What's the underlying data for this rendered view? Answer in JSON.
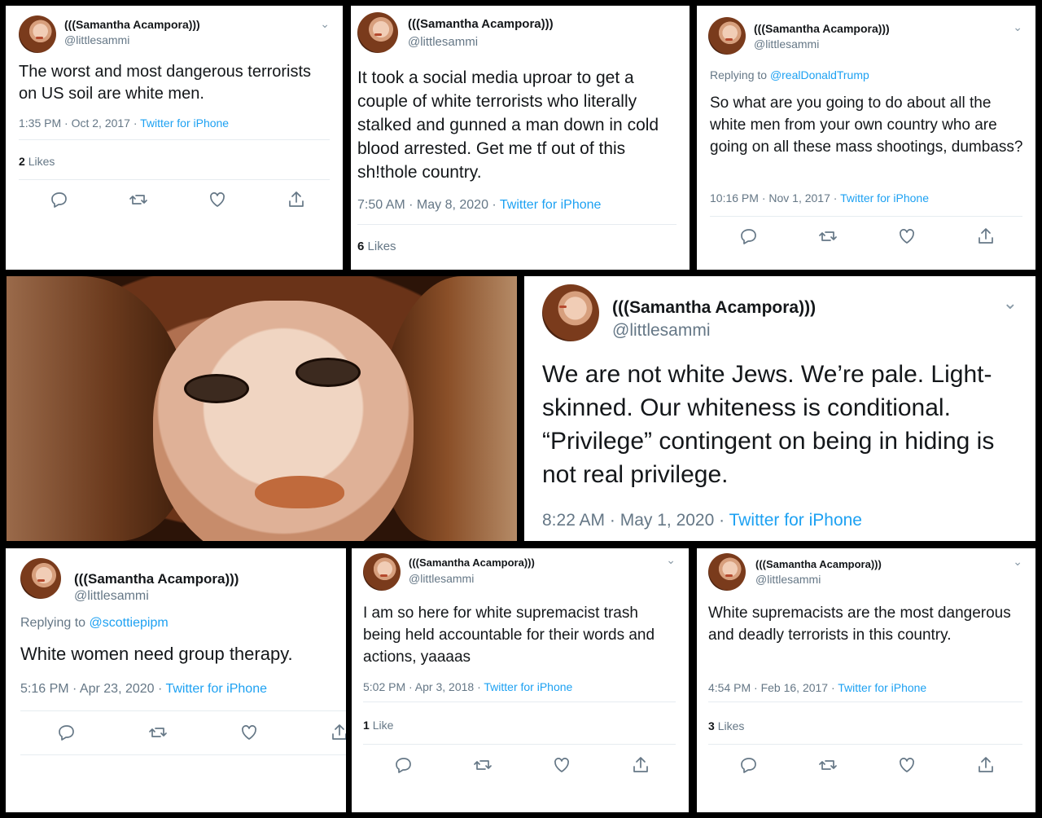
{
  "author": {
    "name": "(((Samantha Acampora)))",
    "handle": "@littlesammi"
  },
  "icons": {
    "chevron": "chevron-down-icon",
    "reply": "reply-icon",
    "retweet": "retweet-icon",
    "like": "heart-icon",
    "share": "share-icon"
  },
  "accent_color": "#1da1f2",
  "tweets": [
    {
      "text": "The worst and most dangerous terrorists on US soil are white men.",
      "time": "1:35 PM · Oct 2, 2017 · ",
      "source": "Twitter for iPhone",
      "likes_count": "2",
      "likes_label": "Likes"
    },
    {
      "text": "It took a social media uproar to get a couple of white terrorists who literally stalked and gunned a man down in cold blood arrested. Get me tf out of this sh!thole country.",
      "time": "7:50 AM · May 8, 2020 · ",
      "source": "Twitter for iPhone",
      "likes_count": "6",
      "likes_label": "Likes"
    },
    {
      "reply_prefix": "Replying to ",
      "reply_to": "@realDonaldTrump",
      "text": "So what are you going to do about all the white men from your own country who are going on all these mass shootings, dumbass?",
      "time": "10:16 PM · Nov 1, 2017 · ",
      "source": "Twitter for iPhone"
    },
    {
      "text": "We are not white Jews. We’re pale. Light-skinned. Our whiteness is conditional. “Privilege” contingent on being in hiding is not real privilege.",
      "time": "8:22 AM · May 1, 2020 · ",
      "source": "Twitter for iPhone"
    },
    {
      "reply_prefix": "Replying to ",
      "reply_to": "@scottiepipm",
      "text": "White women need group therapy.",
      "time": "5:16 PM · Apr 23, 2020 · ",
      "source": "Twitter for iPhone"
    },
    {
      "text": "I am so here for white supremacist trash being held accountable for their words and actions, yaaaas",
      "time": "5:02 PM · Apr 3, 2018 · ",
      "source": "Twitter for iPhone",
      "likes_count": "1",
      "likes_label": "Like"
    },
    {
      "text": "White supremacists are the most dangerous and deadly terrorists in this country.",
      "time": "4:54 PM · Feb 16, 2017 · ",
      "source": "Twitter for iPhone",
      "likes_count": "3",
      "likes_label": "Likes"
    }
  ]
}
